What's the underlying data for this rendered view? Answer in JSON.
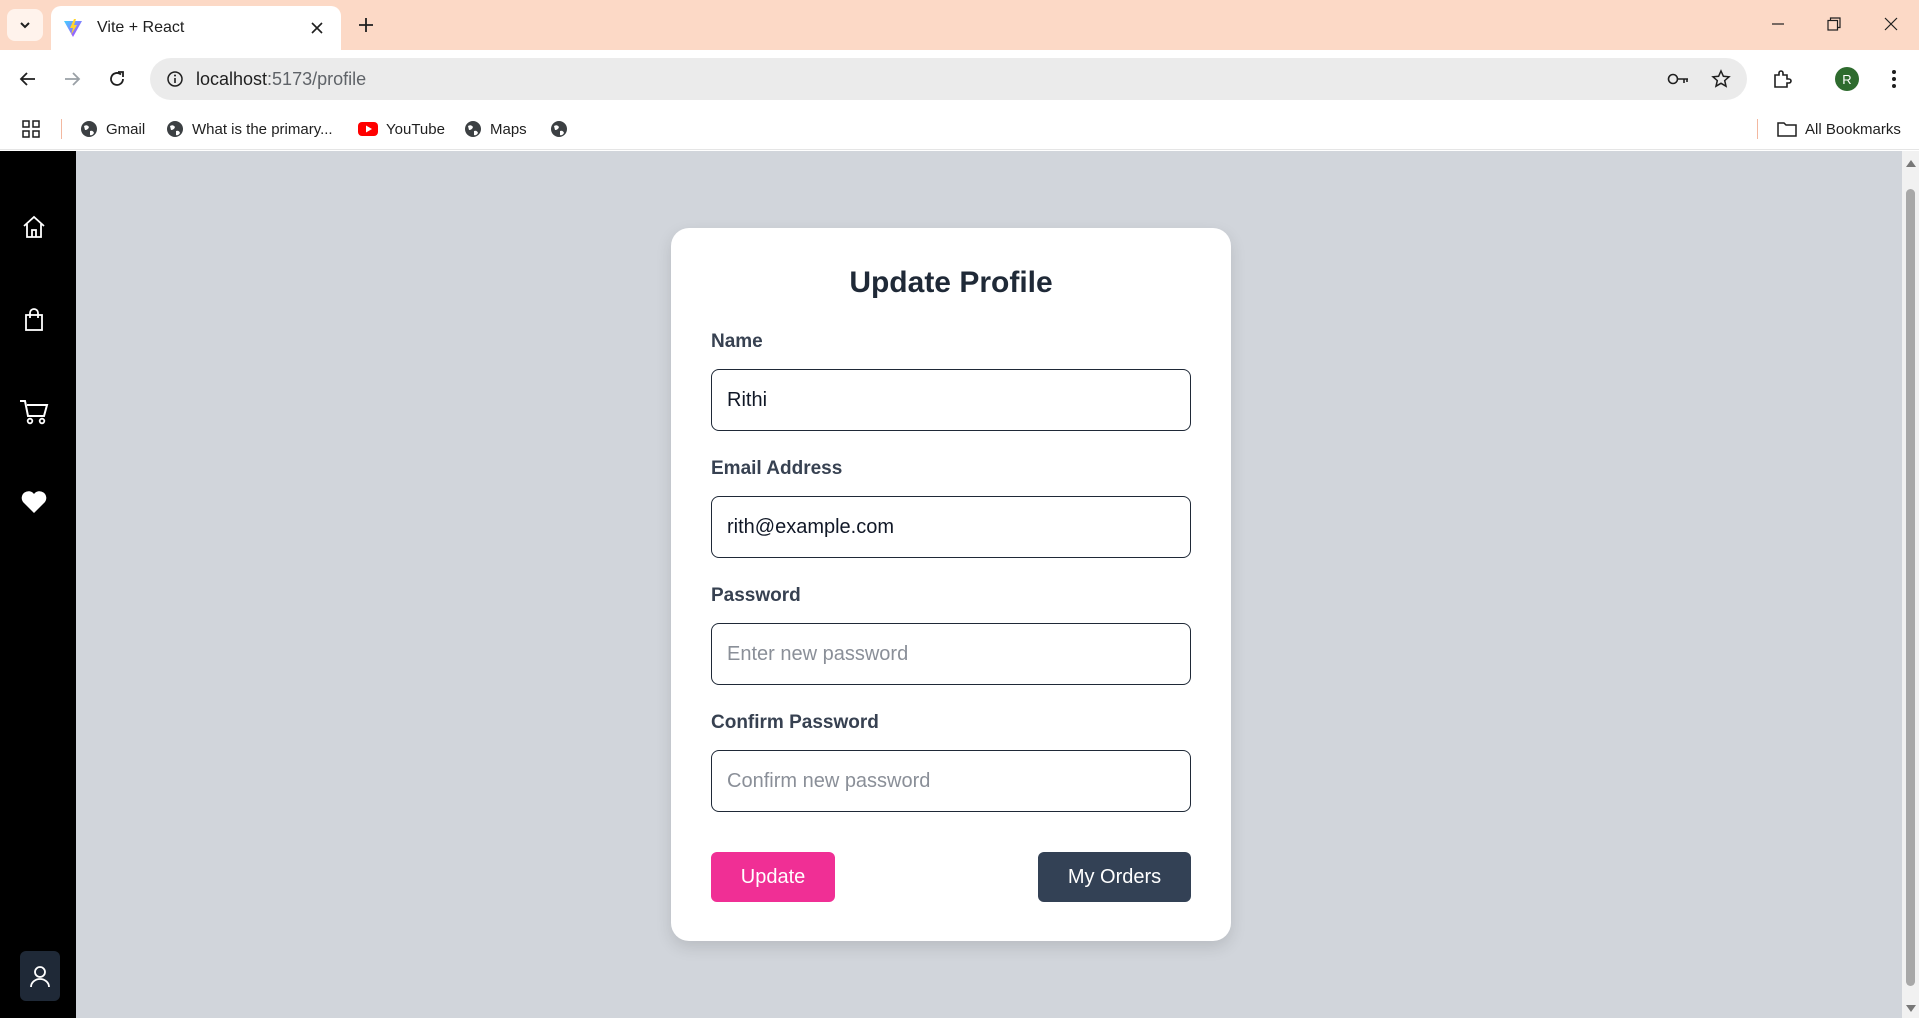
{
  "browser": {
    "tab_title": "Vite + React",
    "url_host": "localhost",
    "url_path": ":5173/profile",
    "profile_initial": "R",
    "bookmarks": [
      {
        "label": "Gmail",
        "icon": "globe-icon"
      },
      {
        "label": "What is the primary...",
        "icon": "globe-icon"
      },
      {
        "label": "YouTube",
        "icon": "youtube-icon"
      },
      {
        "label": "Maps",
        "icon": "globe-icon"
      },
      {
        "label": "",
        "icon": "globe-icon"
      }
    ],
    "all_bookmarks_label": "All Bookmarks"
  },
  "sidebar": {
    "items": [
      {
        "icon": "home-icon"
      },
      {
        "icon": "shopping-bag-icon"
      },
      {
        "icon": "cart-icon"
      },
      {
        "icon": "heart-icon"
      }
    ],
    "user_icon": "user-icon"
  },
  "form": {
    "title": "Update Profile",
    "name_label": "Name",
    "name_value": "Rithi",
    "email_label": "Email Address",
    "email_value": "rith@example.com",
    "password_label": "Password",
    "password_placeholder": "Enter new password",
    "confirm_label": "Confirm Password",
    "confirm_placeholder": "Confirm new password",
    "update_button": "Update",
    "orders_button": "My Orders"
  },
  "colors": {
    "tabbar_bg": "#fcd9c6",
    "page_bg": "#d1d5db",
    "sidebar_bg": "#000000",
    "update_button": "#f02f95",
    "orders_button": "#334155"
  }
}
